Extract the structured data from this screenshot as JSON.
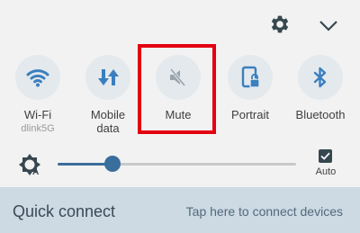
{
  "header": {
    "settings_icon": "gear-icon",
    "expand_icon": "chevron-down-icon"
  },
  "toggles": [
    {
      "id": "wifi",
      "label": "Wi-Fi",
      "sub": "dlink5G",
      "icon": "wifi-icon",
      "color": "#3b7fbf"
    },
    {
      "id": "mobile-data",
      "label": "Mobile\ndata",
      "icon": "mobile-data-icon",
      "color": "#3b7fbf"
    },
    {
      "id": "mute",
      "label": "Mute",
      "icon": "mute-icon",
      "color": "#9aa4ab",
      "highlighted": true
    },
    {
      "id": "portrait",
      "label": "Portrait",
      "icon": "portrait-lock-icon",
      "color": "#3b7fbf"
    },
    {
      "id": "bluetooth",
      "label": "Bluetooth",
      "icon": "bluetooth-icon",
      "color": "#3b7fbf"
    }
  ],
  "brightness": {
    "level": 0.23,
    "auto_label": "Auto",
    "auto_checked": true
  },
  "quick_connect": {
    "title": "Quick connect",
    "hint": "Tap here to connect devices"
  },
  "colors": {
    "accent": "#3b7fbf",
    "slider": "#3a6e9c",
    "highlight": "#e30012",
    "qc_bg": "#cdd9e3"
  }
}
